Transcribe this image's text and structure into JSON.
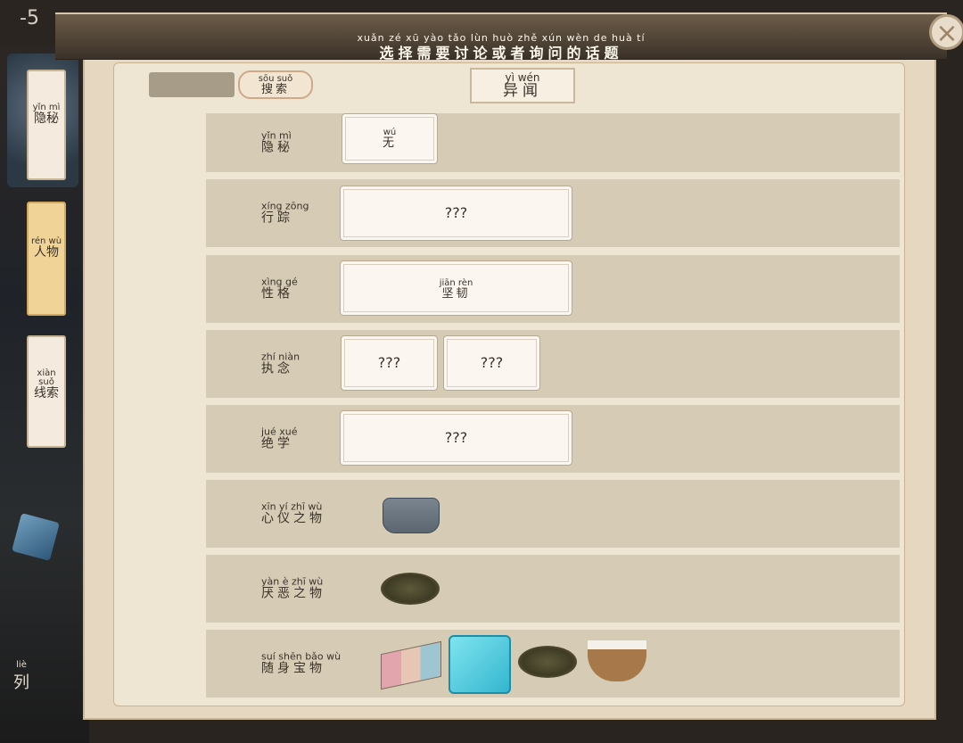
{
  "counter": "-5",
  "banner": {
    "pinyin": "xuǎn zé  xū yào tǎo lùn huò zhě xún wèn de huà tí",
    "title": "选择需要讨论或者询问的话题"
  },
  "close_icon": "×",
  "search": {
    "value": "",
    "button_pinyin": "sōu suǒ",
    "button_label": "搜索"
  },
  "header_tab": {
    "pinyin": "yì wén",
    "label": "异闻"
  },
  "side_tabs": [
    {
      "pinyin": "yǐn mì",
      "label": "隐秘",
      "active": false
    },
    {
      "pinyin": "rén wù",
      "label": "人物",
      "active": true
    },
    {
      "pinyin": "xiàn suǒ",
      "label": "线索",
      "active": false
    }
  ],
  "side_bottom": {
    "pinyin": "liè",
    "label": "列"
  },
  "rows": [
    {
      "label_pinyin": "yǐn mì",
      "label": "隐秘",
      "cards": [
        {
          "pinyin": "wú",
          "text": "无"
        }
      ]
    },
    {
      "label_pinyin": "xíng zōng",
      "label": "行踪",
      "cards": [
        {
          "text": "???"
        }
      ]
    },
    {
      "label_pinyin": "xìng gé",
      "label": "性格",
      "cards": [
        {
          "pinyin": "jiān rèn",
          "text": "坚韧"
        }
      ]
    },
    {
      "label_pinyin": "zhí niàn",
      "label": "执念",
      "cards": [
        {
          "text": "???"
        },
        {
          "text": "???"
        }
      ]
    },
    {
      "label_pinyin": "jué xué",
      "label": "绝学",
      "cards": [
        {
          "text": "???"
        }
      ]
    },
    {
      "label_pinyin": "xīn yí zhī wù",
      "label": "心仪之物",
      "items": [
        "clothes-icon"
      ]
    },
    {
      "label_pinyin": "yàn è zhī wù",
      "label": "厌恶之物",
      "items": [
        "rubbish-icon"
      ]
    },
    {
      "label_pinyin": "suí shēn bǎo wù",
      "label": "随身宝物",
      "items": [
        "books-icon",
        "ice-block-icon",
        "rubbish-icon",
        "cotton-basket-icon"
      ]
    }
  ]
}
